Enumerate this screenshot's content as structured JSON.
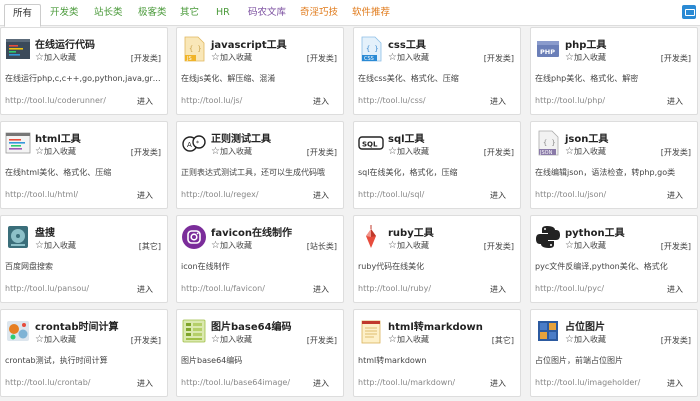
{
  "tabs": [
    {
      "label": "所有",
      "style": "active"
    },
    {
      "label": "开发类",
      "style": "green"
    },
    {
      "label": "站长类",
      "style": "green"
    },
    {
      "label": "极客类",
      "style": "green"
    },
    {
      "label": "其它",
      "style": "green"
    },
    {
      "label": "HR",
      "style": "green"
    },
    {
      "label": "码农文库",
      "style": "purple"
    },
    {
      "label": "奇淫巧技",
      "style": "orange"
    },
    {
      "label": "软件推荐",
      "style": "orange"
    }
  ],
  "fav_label": "加入收藏",
  "enter_label": "进入",
  "tools": [
    {
      "title": "在线运行代码",
      "category": "[开发类]",
      "desc": "在线运行php,c,c++,go,python,java,groovy...",
      "url": "http://tool.lu/coderunner/",
      "icon": "code-terminal-icon"
    },
    {
      "title": "javascript工具",
      "category": "[开发类]",
      "desc": "在线js美化、解压缩、混淆",
      "url": "http://tool.lu/js/",
      "icon": "js-file-icon"
    },
    {
      "title": "css工具",
      "category": "[开发类]",
      "desc": "在线css美化、格式化、压缩",
      "url": "http://tool.lu/css/",
      "icon": "css-file-icon"
    },
    {
      "title": "php工具",
      "category": "[开发类]",
      "desc": "在线php美化、格式化、解密",
      "url": "http://tool.lu/php/",
      "icon": "php-icon"
    },
    {
      "title": "html工具",
      "category": "[开发类]",
      "desc": "在线html美化、格式化、压缩",
      "url": "http://tool.lu/html/",
      "icon": "html-editor-icon"
    },
    {
      "title": "正则测试工具",
      "category": "[开发类]",
      "desc": "正则表达式测试工具，还可以生成代码哦",
      "url": "http://tool.lu/regex/",
      "icon": "regex-icon"
    },
    {
      "title": "sql工具",
      "category": "[开发类]",
      "desc": "sql在线美化，格式化，压缩",
      "url": "http://tool.lu/sql/",
      "icon": "sql-icon"
    },
    {
      "title": "json工具",
      "category": "[开发类]",
      "desc": "在线编辑json，语法检查，转php,go类",
      "url": "http://tool.lu/json/",
      "icon": "json-file-icon"
    },
    {
      "title": "盘搜",
      "category": "[其它]",
      "desc": "百度网盘搜索",
      "url": "http://tool.lu/pansou/",
      "icon": "disk-icon"
    },
    {
      "title": "favicon在线制作",
      "category": "[站长类]",
      "desc": "icon在线制作",
      "url": "http://tool.lu/favicon/",
      "icon": "favicon-icon"
    },
    {
      "title": "ruby工具",
      "category": "[开发类]",
      "desc": "ruby代码在线美化",
      "url": "http://tool.lu/ruby/",
      "icon": "ruby-icon"
    },
    {
      "title": "python工具",
      "category": "[开发类]",
      "desc": "pyc文件反编译,python美化、格式化",
      "url": "http://tool.lu/pyc/",
      "icon": "python-icon"
    },
    {
      "title": "crontab时间计算",
      "category": "[开发类]",
      "desc": "crontab测试，执行时间计算",
      "url": "http://tool.lu/crontab/",
      "icon": "crontab-icon"
    },
    {
      "title": "图片base64编码",
      "category": "[开发类]",
      "desc": "图片base64编码",
      "url": "http://tool.lu/base64image/",
      "icon": "base64-image-icon"
    },
    {
      "title": "html转markdown",
      "category": "[其它]",
      "desc": "html转markdown",
      "url": "http://tool.lu/markdown/",
      "icon": "markdown-notepad-icon"
    },
    {
      "title": "占位图片",
      "category": "[开发类]",
      "desc": "占位图片，前端占位图片",
      "url": "http://tool.lu/imageholder/",
      "icon": "placeholder-image-icon"
    }
  ]
}
